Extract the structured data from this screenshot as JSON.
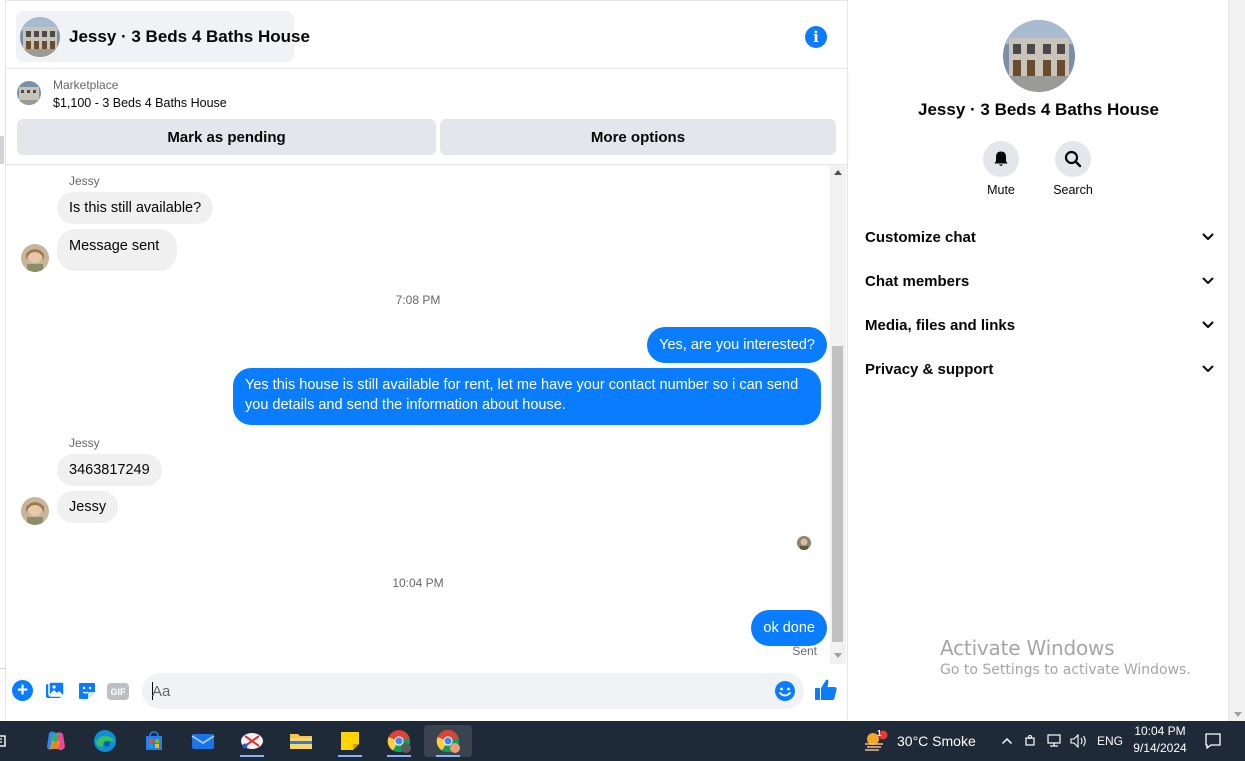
{
  "chat": {
    "title": "Jessy · 3 Beds 4 Baths House",
    "marketplace_label": "Marketplace",
    "listing": "$1,100 - 3 Beds 4 Baths House",
    "mark_pending_label": "Mark as pending",
    "more_options_label": "More options"
  },
  "messages": {
    "sender_1": "Jessy",
    "in_1": "Is this still available?",
    "in_2": "Message sent",
    "time_1": "7:08 PM",
    "out_1": "Yes, are you interested?",
    "out_2": "Yes this house is still available for rent, let me have your contact number so i can send you details and send the information about house.",
    "sender_2": "Jessy",
    "in_3": "3463817249",
    "in_4": "Jessy",
    "time_2": "10:04 PM",
    "out_3": "ok done",
    "status": "Sent"
  },
  "composer": {
    "placeholder": "Aa",
    "gif_label": "GIF"
  },
  "info_panel": {
    "title": "Jessy · 3 Beds 4 Baths House",
    "mute_label": "Mute",
    "search_label": "Search",
    "rows": [
      "Customize chat",
      "Chat members",
      "Media, files and links",
      "Privacy & support"
    ]
  },
  "watermark": {
    "line1": "Activate Windows",
    "line2": "Go to Settings to activate Windows."
  },
  "taskbar": {
    "weather": "30°C  Smoke",
    "language": "ENG",
    "time": "10:04 PM",
    "date": "9/14/2024",
    "weather_badge": "1"
  },
  "colors": {
    "messenger_blue": "#0a7cff",
    "bubble_gray": "#f0f0f0",
    "taskbar_bg": "#1f2a38"
  }
}
